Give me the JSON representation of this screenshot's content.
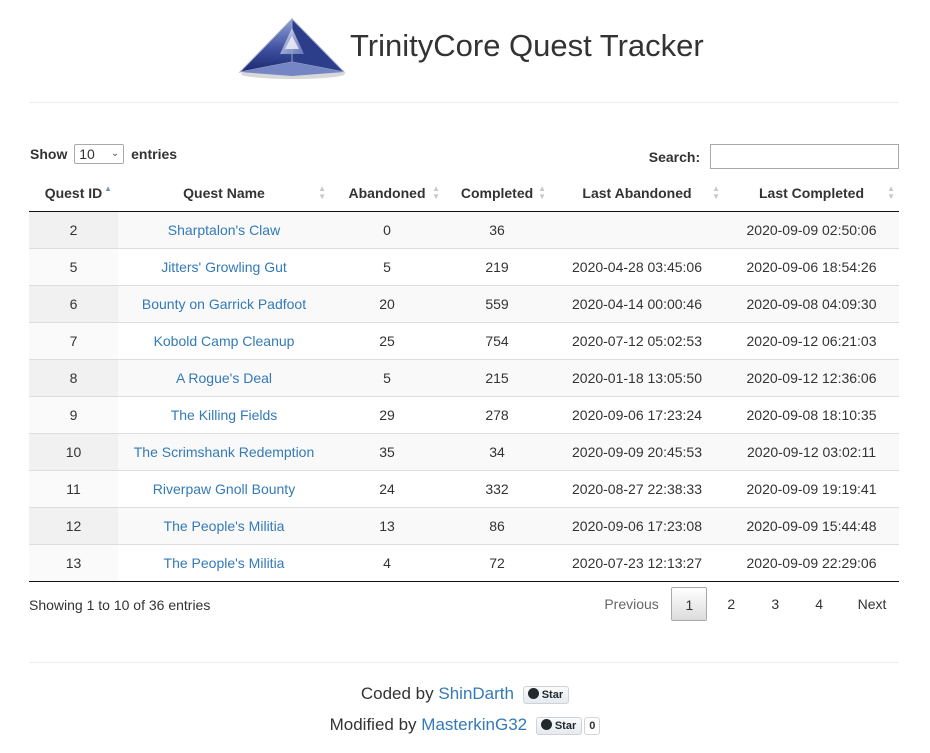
{
  "header": {
    "title": "TrinityCore Quest Tracker",
    "logo": "trinitycore-pyramid-logo"
  },
  "controls": {
    "show_label": "Show",
    "page_length": "10",
    "entries_label": "entries",
    "search_label": "Search:",
    "search_value": ""
  },
  "table": {
    "columns": [
      "Quest ID",
      "Quest Name",
      "Abandoned",
      "Completed",
      "Last Abandoned",
      "Last Completed"
    ],
    "sorted_column": "Quest ID",
    "sort_direction": "ascending",
    "rows": [
      {
        "id": "2",
        "name": "Sharptalon's Claw",
        "abandoned": "0",
        "completed": "36",
        "last_abandoned": "",
        "last_completed": "2020-09-09 02:50:06"
      },
      {
        "id": "5",
        "name": "Jitters' Growling Gut",
        "abandoned": "5",
        "completed": "219",
        "last_abandoned": "2020-04-28 03:45:06",
        "last_completed": "2020-09-06 18:54:26"
      },
      {
        "id": "6",
        "name": "Bounty on Garrick Padfoot",
        "abandoned": "20",
        "completed": "559",
        "last_abandoned": "2020-04-14 00:00:46",
        "last_completed": "2020-09-08 04:09:30"
      },
      {
        "id": "7",
        "name": "Kobold Camp Cleanup",
        "abandoned": "25",
        "completed": "754",
        "last_abandoned": "2020-07-12 05:02:53",
        "last_completed": "2020-09-12 06:21:03"
      },
      {
        "id": "8",
        "name": "A Rogue's Deal",
        "abandoned": "5",
        "completed": "215",
        "last_abandoned": "2020-01-18 13:05:50",
        "last_completed": "2020-09-12 12:36:06"
      },
      {
        "id": "9",
        "name": "The Killing Fields",
        "abandoned": "29",
        "completed": "278",
        "last_abandoned": "2020-09-06 17:23:24",
        "last_completed": "2020-09-08 18:10:35"
      },
      {
        "id": "10",
        "name": "The Scrimshank Redemption",
        "abandoned": "35",
        "completed": "34",
        "last_abandoned": "2020-09-09 20:45:53",
        "last_completed": "2020-09-12 03:02:11"
      },
      {
        "id": "11",
        "name": "Riverpaw Gnoll Bounty",
        "abandoned": "24",
        "completed": "332",
        "last_abandoned": "2020-08-27 22:38:33",
        "last_completed": "2020-09-09 19:19:41"
      },
      {
        "id": "12",
        "name": "The People's Militia",
        "abandoned": "13",
        "completed": "86",
        "last_abandoned": "2020-09-06 17:23:08",
        "last_completed": "2020-09-09 15:44:48"
      },
      {
        "id": "13",
        "name": "The People's Militia",
        "abandoned": "4",
        "completed": "72",
        "last_abandoned": "2020-07-23 12:13:27",
        "last_completed": "2020-09-09 22:29:06"
      }
    ]
  },
  "info": "Showing 1 to 10 of 36 entries",
  "pagination": {
    "previous": "Previous",
    "pages": [
      "1",
      "2",
      "3",
      "4"
    ],
    "current": "1",
    "next": "Next"
  },
  "footer": {
    "coded_prefix": "Coded by",
    "coded_author": "ShinDarth",
    "modified_prefix": "Modified by",
    "modified_author": "MasterkinG32",
    "star_label": "Star",
    "star_count": "0",
    "github_icon": "github-octocat-icon"
  },
  "colors": {
    "link": "#337ab7",
    "text": "#333333",
    "stripe": "#f9f9f9"
  }
}
